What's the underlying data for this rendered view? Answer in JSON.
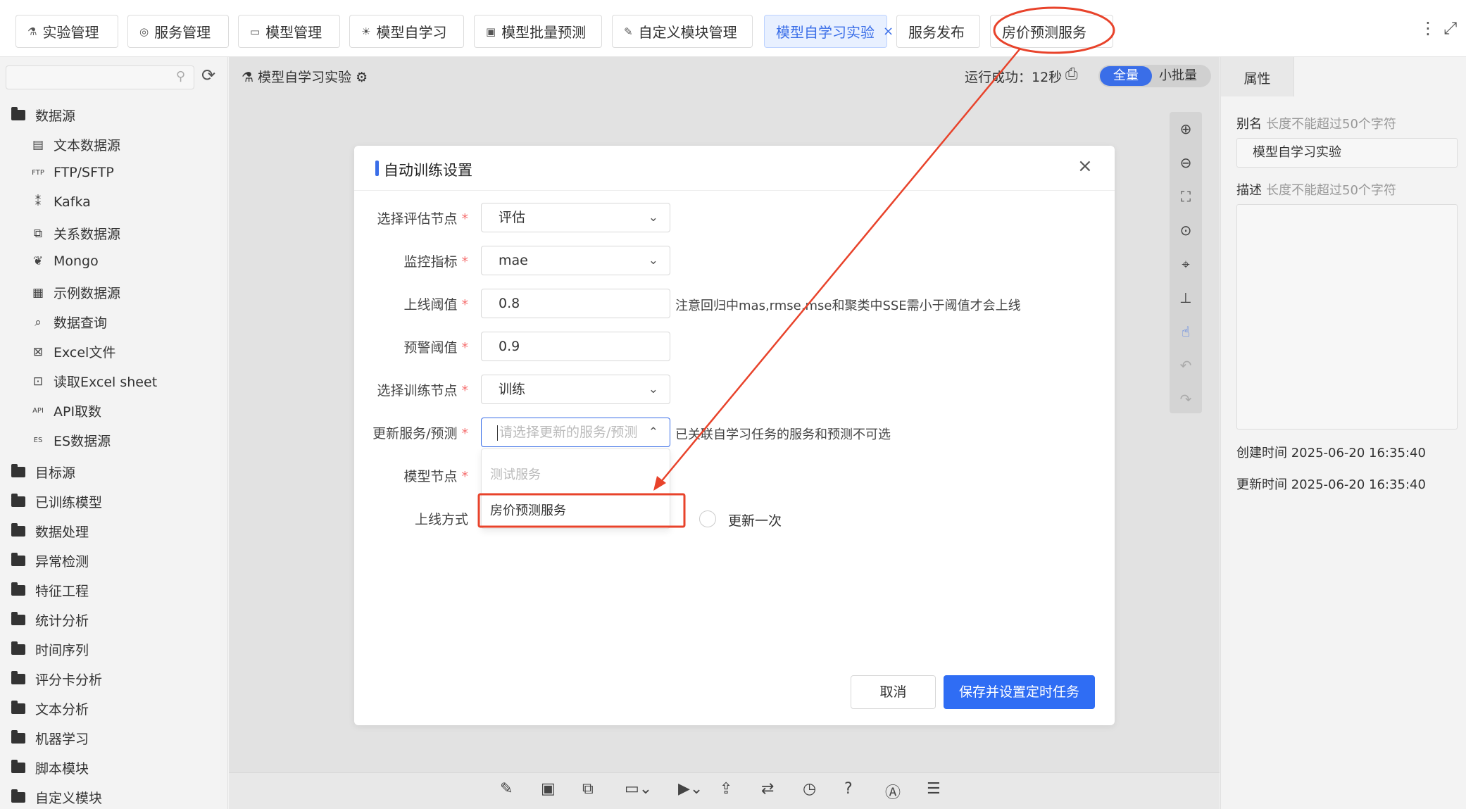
{
  "top_tabs": [
    {
      "label": "实验管理",
      "icon": "flask-icon"
    },
    {
      "label": "服务管理",
      "icon": "service-icon"
    },
    {
      "label": "模型管理",
      "icon": "model-icon"
    },
    {
      "label": "模型自学习",
      "icon": "bulb-icon"
    },
    {
      "label": "模型批量预测",
      "icon": "image-icon"
    },
    {
      "label": "自定义模块管理",
      "icon": "pen-icon"
    },
    {
      "label": "模型自学习实验",
      "active": true,
      "close": "×"
    },
    {
      "label": "服务发布"
    },
    {
      "label": "房价预测服务"
    }
  ],
  "top_right": {
    "more_icon": "⋮",
    "expand_icon": "⤢"
  },
  "sidebar": {
    "search_placeholder": "",
    "tree": [
      {
        "label": "数据源",
        "type": "folder"
      },
      {
        "label": "文本数据源",
        "icon": "text-source-icon"
      },
      {
        "label": "FTP/SFTP",
        "icon": "ftp-icon"
      },
      {
        "label": "Kafka",
        "icon": "kafka-icon"
      },
      {
        "label": "关系数据源",
        "icon": "relation-icon"
      },
      {
        "label": "Mongo",
        "icon": "mongo-icon"
      },
      {
        "label": "示例数据源",
        "icon": "example-icon"
      },
      {
        "label": "数据查询",
        "icon": "query-icon"
      },
      {
        "label": "Excel文件",
        "icon": "excel-icon"
      },
      {
        "label": "读取Excel sheet",
        "icon": "excel-sheet-icon"
      },
      {
        "label": "API取数",
        "icon": "api-icon"
      },
      {
        "label": "ES数据源",
        "icon": "es-icon"
      },
      {
        "label": "目标源",
        "type": "folder"
      },
      {
        "label": "已训练模型",
        "type": "folder"
      },
      {
        "label": "数据处理",
        "type": "folder"
      },
      {
        "label": "异常检测",
        "type": "folder"
      },
      {
        "label": "特征工程",
        "type": "folder"
      },
      {
        "label": "统计分析",
        "type": "folder"
      },
      {
        "label": "时间序列",
        "type": "folder"
      },
      {
        "label": "评分卡分析",
        "type": "folder"
      },
      {
        "label": "文本分析",
        "type": "folder"
      },
      {
        "label": "机器学习",
        "type": "folder"
      },
      {
        "label": "脚本模块",
        "type": "folder"
      },
      {
        "label": "自定义模块",
        "type": "folder"
      }
    ]
  },
  "canvas": {
    "title": "模型自学习实验",
    "run_status": "运行成功：12秒",
    "mode_full": "全量",
    "mode_small": "小批量"
  },
  "properties": {
    "tab": "属性",
    "alias_label": "别名",
    "alias_hint": "长度不能超过50个字符",
    "alias_value": "模型自学习实验",
    "desc_label": "描述",
    "desc_hint": "长度不能超过50个字符",
    "created": "创建时间 2025-06-20 16:35:40",
    "updated": "更新时间 2025-06-20 16:35:40"
  },
  "modal": {
    "title": "自动训练设置",
    "close": "×",
    "fields": {
      "eval_node": {
        "label": "选择评估节点",
        "value": "评估"
      },
      "metric": {
        "label": "监控指标",
        "value": "mae"
      },
      "online_threshold": {
        "label": "上线阈值",
        "value": "0.8",
        "hint": "注意回归中mas,rmse,mse和聚类中SSE需小于阈值才会上线"
      },
      "warn_threshold": {
        "label": "预警阈值",
        "value": "0.9"
      },
      "train_node": {
        "label": "选择训练节点",
        "value": "训练"
      },
      "update_service": {
        "label": "更新服务/预测",
        "placeholder": "请选择更新的服务/预测",
        "hint": "已关联自学习任务的服务和预测不可选"
      },
      "model_node": {
        "label": "模型节点"
      },
      "online_mode": {
        "label": "上线方式",
        "option": "更新一次"
      }
    },
    "dropdown_options": [
      {
        "label": "测试服务",
        "disabled": true
      },
      {
        "label": "房价预测服务",
        "disabled": false
      }
    ],
    "required_mark": "*",
    "cancel": "取消",
    "save": "保存并设置定时任务"
  },
  "colors": {
    "primary": "#2f6df4",
    "annotation": "#e8432b",
    "required": "#f56c6c"
  }
}
